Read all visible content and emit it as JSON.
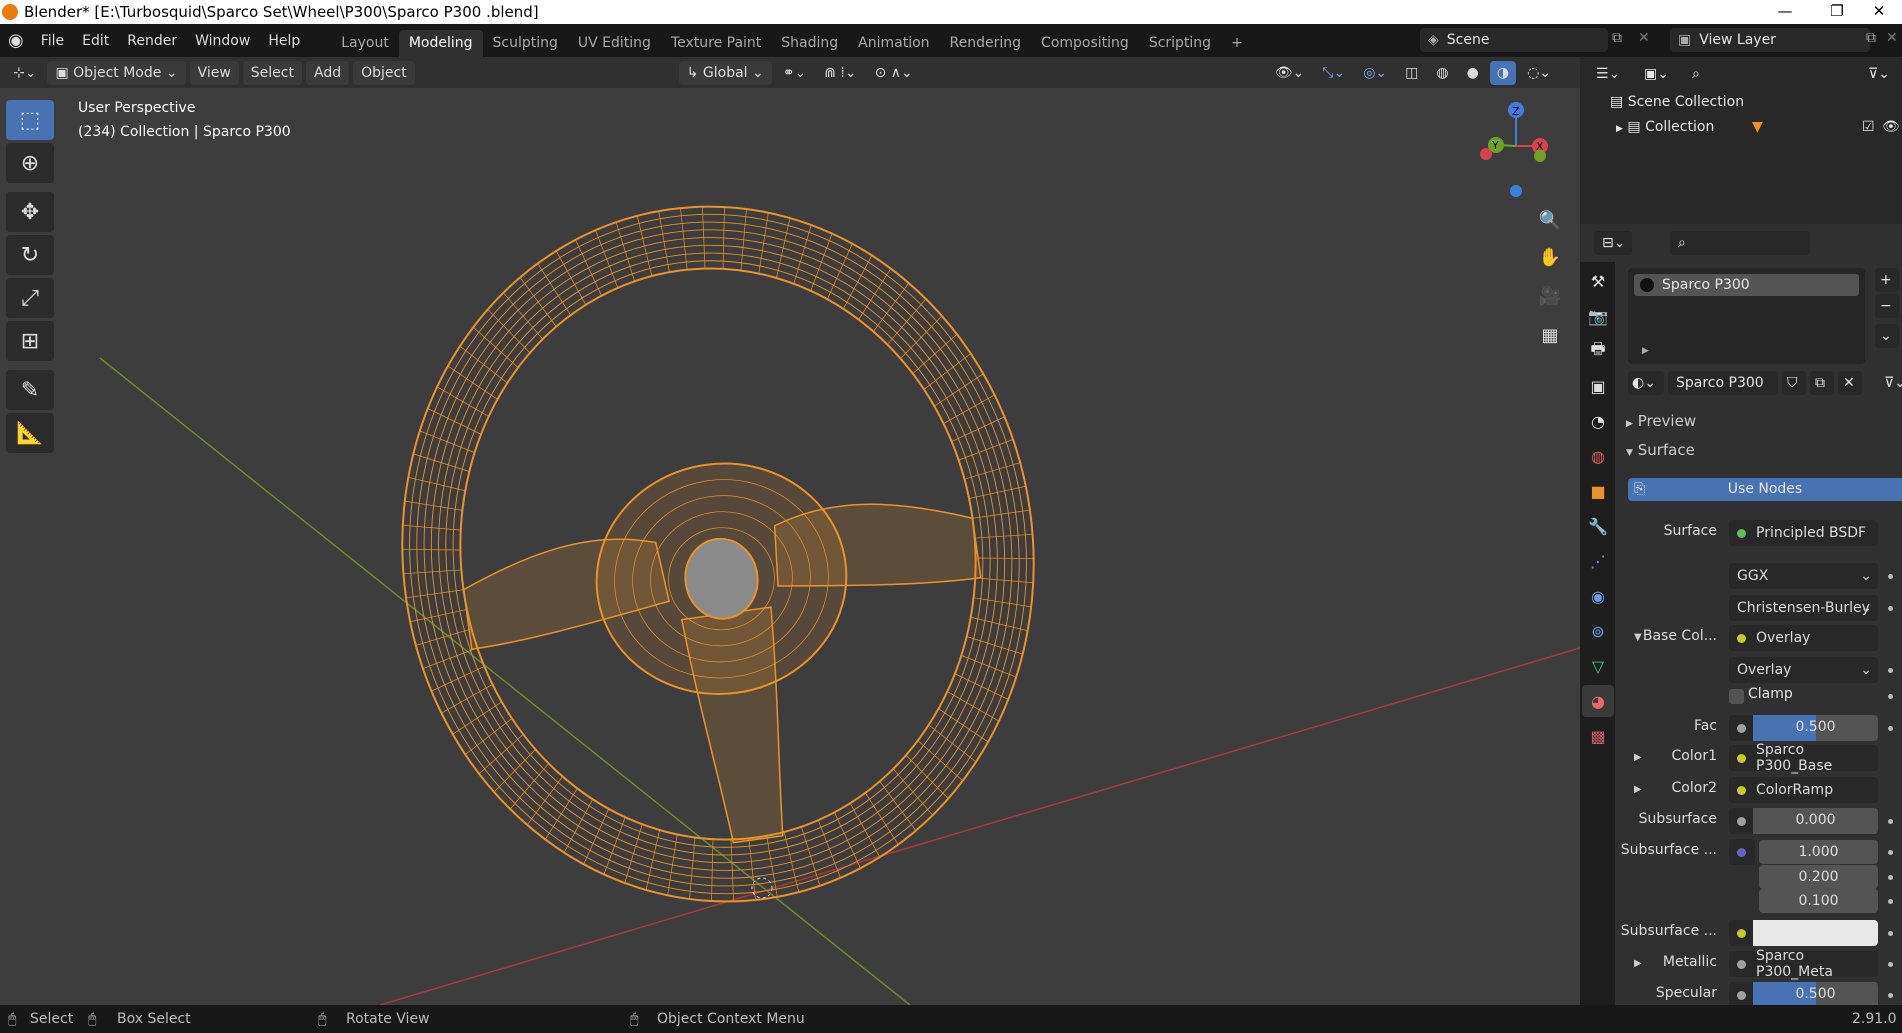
{
  "window": {
    "title": "Blender* [E:\\Turbosquid\\Sparco Set\\Wheel\\P300\\Sparco P300 .blend]",
    "minimize": "—",
    "maximize": "❐",
    "close": "✕"
  },
  "menus": [
    "File",
    "Edit",
    "Render",
    "Window",
    "Help"
  ],
  "workspaces": [
    {
      "label": "Layout"
    },
    {
      "label": "Modeling",
      "active": true
    },
    {
      "label": "Sculpting"
    },
    {
      "label": "UV Editing"
    },
    {
      "label": "Texture Paint"
    },
    {
      "label": "Shading"
    },
    {
      "label": "Animation"
    },
    {
      "label": "Rendering"
    },
    {
      "label": "Compositing"
    },
    {
      "label": "Scripting"
    }
  ],
  "add_workspace": "+",
  "scene": "Scene",
  "view_layer": "View Layer",
  "header": {
    "mode": "Object Mode",
    "view": "View",
    "select": "Select",
    "add": "Add",
    "object": "Object",
    "orientation": "Global"
  },
  "viewport": {
    "perspective": "User Perspective",
    "info": "(234) Collection | Sparco P300",
    "gizmo": {
      "x": "X",
      "y": "Y",
      "z": "Z"
    }
  },
  "outliner": {
    "scene_collection": "Scene Collection",
    "collection": "Collection"
  },
  "properties": {
    "material_slot": "Sparco P300",
    "material_name": "Sparco P300",
    "preview": "Preview",
    "surface_panel": "Surface",
    "use_nodes": "Use Nodes",
    "rows": [
      {
        "label": "Surface",
        "value": "Principled BSDF",
        "dot": "#5dbf5d"
      },
      {
        "label": "",
        "value": "GGX",
        "dropdown": true
      },
      {
        "label": "",
        "value": "Christensen-Burley",
        "dropdown": true
      },
      {
        "label": "Base Col...",
        "value": "Overlay",
        "dot": "#c7c729"
      },
      {
        "label": "",
        "value": "Overlay",
        "dropdown": true
      },
      {
        "label": "Clamp",
        "checkbox": true
      },
      {
        "label": "Fac",
        "value": "0.500",
        "fill": 0.5,
        "dot": "#a0a0a0"
      },
      {
        "label": "Color1",
        "value": "Sparco P300_Base",
        "dot": "#c7c729"
      },
      {
        "label": "Color2",
        "value": "ColorRamp",
        "dot": "#c7c729"
      },
      {
        "label": "Subsurface",
        "value": "0.000",
        "fill": 0,
        "dot": "#a0a0a0"
      },
      {
        "label": "Subsurface ...",
        "values": [
          "1.000",
          "0.200",
          "0.100"
        ],
        "dot": "#6363c7"
      },
      {
        "label": "Subsurface ...",
        "color": "#e8e8e8",
        "dot": "#c7c729"
      },
      {
        "label": "Metallic",
        "value": "Sparco P300_Meta",
        "dot": "#a0a0a0"
      },
      {
        "label": "Specular",
        "value": "0.500",
        "fill": 0.5,
        "dot": "#a0a0a0"
      }
    ]
  },
  "status": {
    "select": "Select",
    "box_select": "Box Select",
    "rotate": "Rotate View",
    "context": "Object Context Menu",
    "version": "2.91.0"
  },
  "colors": {
    "accent": "#4772b3",
    "wire": "#e8932a"
  }
}
